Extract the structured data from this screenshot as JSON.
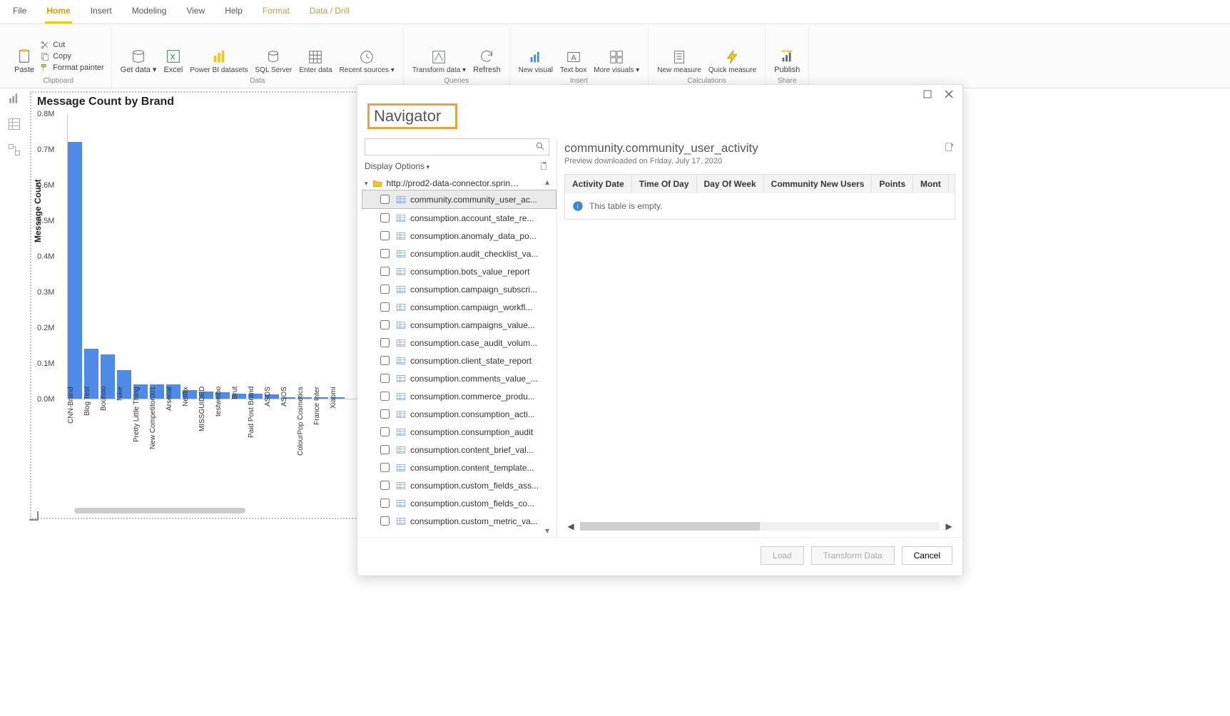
{
  "menu": {
    "file": "File",
    "home": "Home",
    "insert": "Insert",
    "modeling": "Modeling",
    "view": "View",
    "help": "Help",
    "format": "Format",
    "datadrill": "Data / Drill"
  },
  "ribbon": {
    "clipboard": {
      "paste": "Paste",
      "cut": "Cut",
      "copy": "Copy",
      "format_painter": "Format painter",
      "group": "Clipboard"
    },
    "data": {
      "get_data": "Get data",
      "excel": "Excel",
      "pbi_ds": "Power BI datasets",
      "sql": "SQL Server",
      "enter": "Enter data",
      "recent": "Recent sources",
      "group": "Data"
    },
    "queries": {
      "transform": "Transform data",
      "refresh": "Refresh",
      "group": "Queries"
    },
    "insert": {
      "new_visual": "New visual",
      "text_box": "Text box",
      "more_visuals": "More visuals",
      "group": "Insert"
    },
    "calc": {
      "new_measure": "New measure",
      "quick_measure": "Quick measure",
      "group": "Calculations"
    },
    "share": {
      "publish": "Publish",
      "group": "Share"
    }
  },
  "chart_data": {
    "type": "bar",
    "title": "Message Count by Brand",
    "ylabel": "Message Count",
    "yticks": [
      "0.0M",
      "0.1M",
      "0.2M",
      "0.3M",
      "0.4M",
      "0.5M",
      "0.6M",
      "0.7M",
      "0.8M"
    ],
    "ylim": [
      0,
      0.8
    ],
    "categories": [
      "CNN-Brand",
      "Blog Test",
      "Boohoo",
      "Nike",
      "Pretty Little Thing",
      "New Competitor001",
      "Arsenal",
      "Netflix",
      "MISSGUIDED",
      "testweibo",
      "Brut",
      "Paid Post Brand",
      "ASOS",
      "ASOS",
      "ColourPop Cosmetics",
      "France Inter",
      "Xiaomi"
    ],
    "values": [
      0.72,
      0.14,
      0.125,
      0.08,
      0.04,
      0.04,
      0.04,
      0.025,
      0.02,
      0.018,
      0.015,
      0.015,
      0.012,
      0.005,
      0.005,
      0.005,
      0.005
    ]
  },
  "navigator": {
    "title": "Navigator",
    "search_placeholder": "",
    "display_options": "Display Options",
    "root": "http://prod2-data-connector.sprinkl...",
    "items": [
      "community.community_user_ac...",
      "consumption.account_state_re...",
      "consumption.anomaly_data_po...",
      "consumption.audit_checklist_va...",
      "consumption.bots_value_report",
      "consumption.campaign_subscri...",
      "consumption.campaign_workfl...",
      "consumption.campaigns_value...",
      "consumption.case_audit_volum...",
      "consumption.client_state_report",
      "consumption.comments_value_...",
      "consumption.commerce_produ...",
      "consumption.consumption_acti...",
      "consumption.consumption_audit",
      "consumption.content_brief_val...",
      "consumption.content_template...",
      "consumption.custom_fields_ass...",
      "consumption.custom_fields_co...",
      "consumption.custom_metric_va..."
    ],
    "preview": {
      "name": "community.community_user_activity",
      "subtitle": "Preview downloaded on Friday, July 17, 2020",
      "columns": [
        "Activity Date",
        "Time Of Day",
        "Day Of Week",
        "Community New Users",
        "Points",
        "Mont"
      ],
      "empty_msg": "This table is empty."
    },
    "buttons": {
      "load": "Load",
      "transform": "Transform Data",
      "cancel": "Cancel"
    }
  }
}
